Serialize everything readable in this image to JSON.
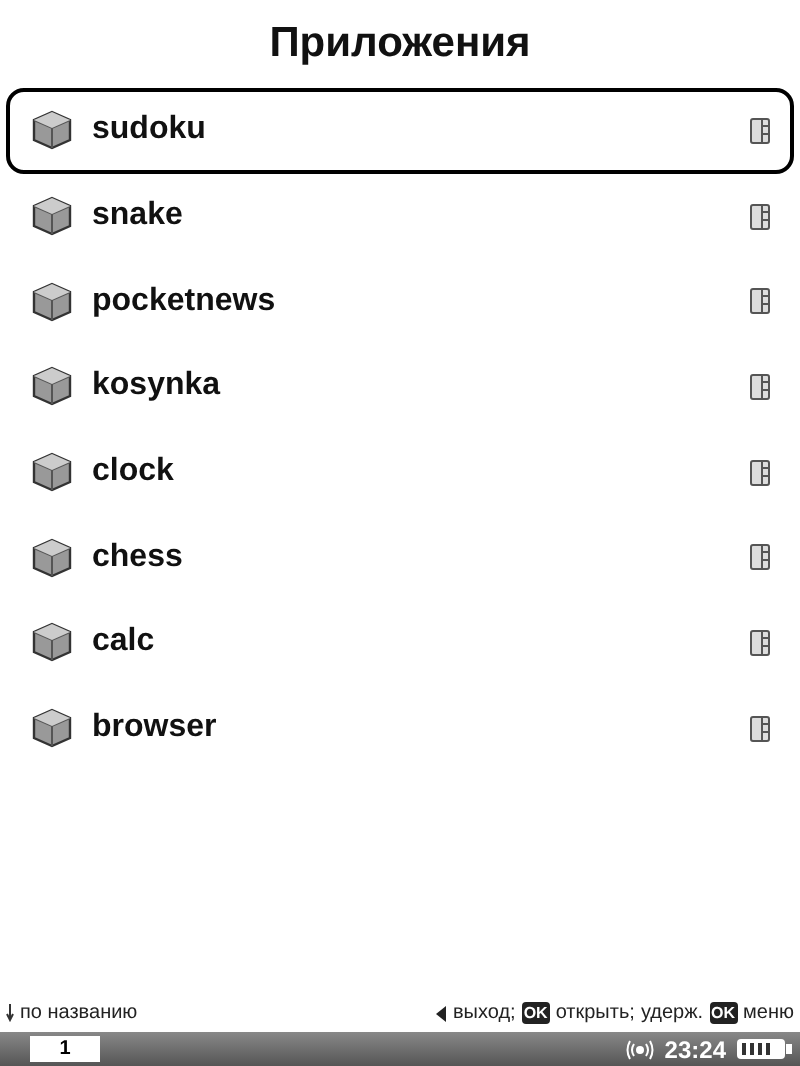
{
  "title": "Приложения",
  "items": [
    {
      "name": "sudoku",
      "selected": true
    },
    {
      "name": "snake",
      "selected": false
    },
    {
      "name": "pocketnews",
      "selected": false
    },
    {
      "name": "kosynka",
      "selected": false
    },
    {
      "name": "clock",
      "selected": false
    },
    {
      "name": "chess",
      "selected": false
    },
    {
      "name": "calc",
      "selected": false
    },
    {
      "name": "browser",
      "selected": false
    }
  ],
  "sort_hint": "по названию",
  "key_hints": [
    {
      "kind": "arrow",
      "label": "выход;"
    },
    {
      "kind": "key",
      "key": "OK",
      "label": "открыть;"
    },
    {
      "kind": "text",
      "label": "удерж."
    },
    {
      "kind": "key",
      "key": "OK",
      "label": "меню"
    }
  ],
  "status_bar": {
    "page": "1",
    "time": "23:24"
  }
}
